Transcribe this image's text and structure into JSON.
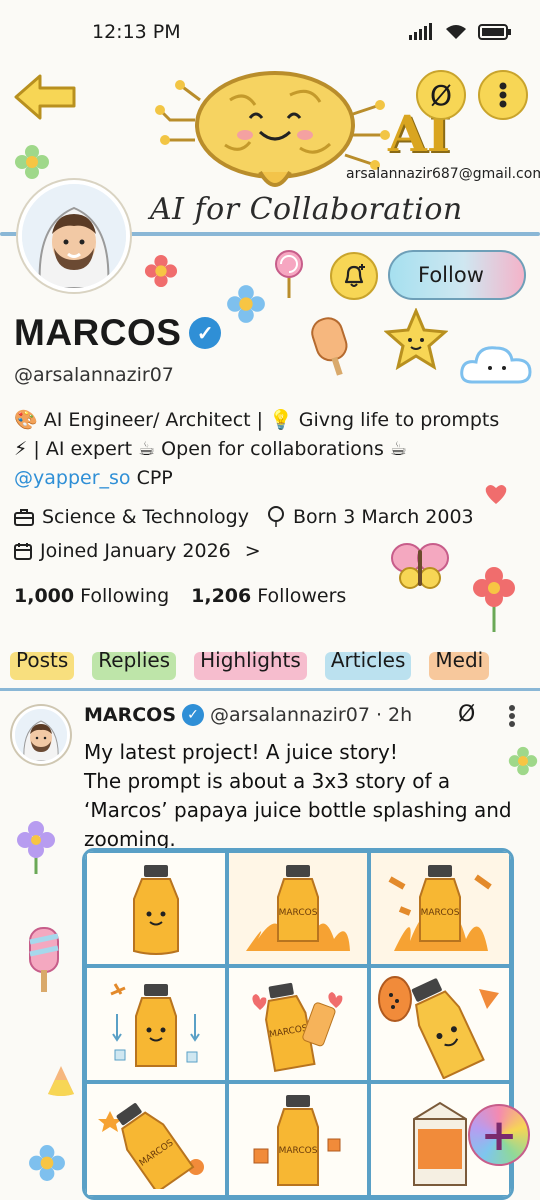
{
  "status_bar": {
    "time": "12:13 PM",
    "battery_icon": "battery-icon",
    "wifi_icon": "wifi-icon",
    "signal_icon": "signal-icon"
  },
  "header": {
    "back_icon": "back-arrow-icon",
    "nolink_glyph": "Ø",
    "banner_letters": "AI",
    "banner_title": "AI for Collaboration",
    "email": "arsalannazir687@gmail.com"
  },
  "profile": {
    "name": "MARCOS",
    "verified_glyph": "✓",
    "handle": "@arsalannazir07",
    "follow_label": "Follow",
    "bio_line1": "🎨 AI Engineer/ Architect | 💡 Givng life to prompts",
    "bio_line2": "⚡ | AI expert     ☕ Open for collaborations ☕",
    "bio_mention": "@yapper_so",
    "bio_suffix": " CPP",
    "category": "Science & Technology",
    "born": "Born 3 March 2003",
    "joined": "Joined January 2026",
    "joined_chevron": ">",
    "following_count": "1,000",
    "following_label": "Following",
    "followers_count": "1,206",
    "followers_label": "Followers"
  },
  "tabs": [
    {
      "label": "Posts",
      "color": "#f7d655"
    },
    {
      "label": "Replies",
      "color": "#a9dd8f"
    },
    {
      "label": "Highlights",
      "color": "#f4a8c0"
    },
    {
      "label": "Articles",
      "color": "#a6d8ec"
    },
    {
      "label": "Medi",
      "color": "#f6b77e"
    }
  ],
  "post": {
    "author": "MARCOS",
    "verified_glyph": "✓",
    "handle_time": "@arsalannazir07 · 2h",
    "nolink_glyph": "Ø",
    "text_line1": "My latest project! A juice story!",
    "text_line2": "The prompt is about a 3x3 story of a ‘Marcos’ papaya juice bottle splashing and zooming.",
    "bottle_label": "MARCOS"
  },
  "fab": {
    "glyph": "+"
  },
  "colors": {
    "accent_blue": "#2f8fd6",
    "accent_yellow": "#f7d655",
    "line_blue": "#8ab7d6"
  }
}
